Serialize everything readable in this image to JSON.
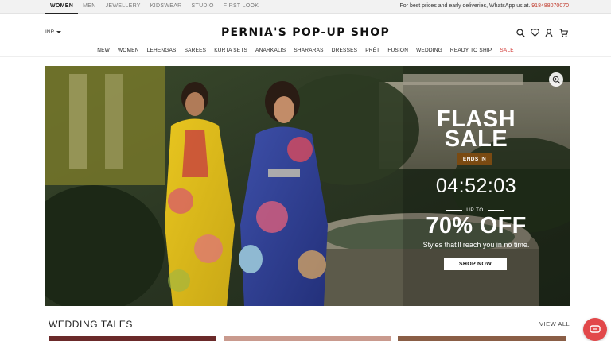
{
  "topbar": {
    "tabs": [
      {
        "label": "WOMEN",
        "active": true
      },
      {
        "label": "MEN",
        "active": false
      },
      {
        "label": "JEWELLERY",
        "active": false
      },
      {
        "label": "KIDSWEAR",
        "active": false
      },
      {
        "label": "STUDIO",
        "active": false
      },
      {
        "label": "FIRST LOOK",
        "active": false
      }
    ],
    "promo_text": "For best prices and early deliveries, WhatsApp us at.",
    "promo_phone": "918488070070"
  },
  "header": {
    "currency": "INR",
    "logo": "PERNIA'S POP-UP SHOP",
    "icons": [
      "search-icon",
      "heart-icon",
      "user-icon",
      "cart-icon"
    ]
  },
  "nav": {
    "items": [
      "NEW",
      "WOMEN",
      "LEHENGAS",
      "SAREES",
      "KURTA SETS",
      "ANARKALIS",
      "SHARARAS",
      "DRESSES",
      "PRÊT",
      "FUSION",
      "WEDDING",
      "READY TO SHIP",
      "SALE"
    ]
  },
  "banner": {
    "title_line1": "FLASH",
    "title_line2": "SALE",
    "ends_label": "ENDS IN",
    "timer": "04:52:03",
    "upto": "UP TO",
    "discount": "70% OFF",
    "tagline": "Styles that'll reach you in no time.",
    "cta": "SHOP NOW"
  },
  "section": {
    "title": "WEDDING TALES",
    "view_all": "VIEW ALL"
  },
  "colors": {
    "sale_red": "#d0312d",
    "phone_red": "#c0392b",
    "chat_button": "#e2484a",
    "ends_badge": "#7a4a12"
  }
}
